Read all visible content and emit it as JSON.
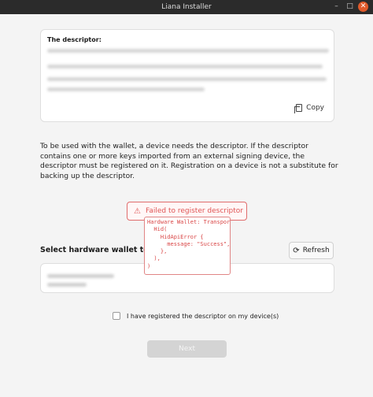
{
  "window": {
    "title": "Liana Installer"
  },
  "descriptor_card": {
    "title": "The descriptor:",
    "copy_label": "Copy"
  },
  "description": "To be used with the wallet, a device needs the descriptor. If the descriptor contains one or more keys imported from an external signing device, the descriptor must be registered on it. Registration on a device is not a substitute for backing up the descriptor.",
  "error": {
    "message": "Failed to register descriptor",
    "details": "Hardware Wallet: Transport(\n  Hid(\n    HidApiError {\n      message: \"Success\",\n    },\n  ),\n)"
  },
  "hardware": {
    "title": "Select hardware wallet to register",
    "refresh_label": "Refresh"
  },
  "confirm": {
    "label": "I have registered the descriptor on my device(s)"
  },
  "next_label": "Next"
}
